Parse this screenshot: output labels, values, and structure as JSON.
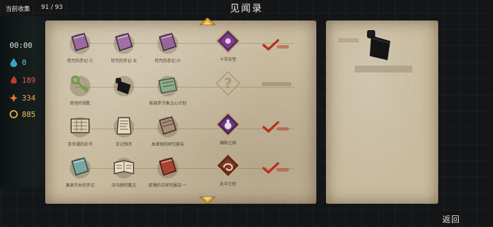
{
  "header": {
    "collect_label": "当前收集",
    "collect_count": "91 / 93",
    "title": "见闻录"
  },
  "hud": {
    "timer": "00:00",
    "stat1": "0",
    "stat2": "189",
    "stat3": "334",
    "stat4": "885"
  },
  "grid": {
    "row1": [
      "符咒的手记·三",
      "符咒的手记·五",
      "符咒的手记·六",
      "十军安堂"
    ],
    "row2": [
      "奇怪的钥匙",
      "",
      "影森罗万象之心计划",
      ""
    ],
    "row3": [
      "百世通的卦书",
      "日记残页",
      "血液帧的研究报告",
      "蛹影之卵"
    ],
    "row4": [
      "黄泉宗女的手记",
      "旧马蹄的散文",
      "航锋的古研究报告·一",
      "此中之蛇"
    ]
  },
  "right_panel": {
    "selected_item": "black pouch"
  },
  "footer": {
    "back_label": "返回"
  }
}
